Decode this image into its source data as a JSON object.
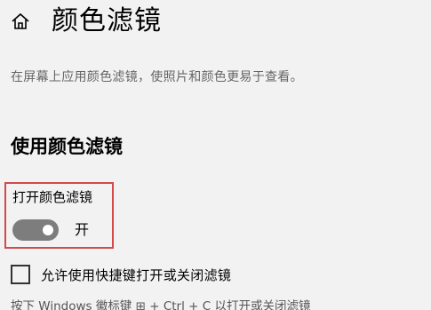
{
  "header": {
    "title": "颜色滤镜",
    "home_icon": "home-icon"
  },
  "description": "在屏幕上应用颜色滤镜，使照片和颜色更易于查看。",
  "section": {
    "title": "使用颜色滤镜",
    "toggle": {
      "label": "打开颜色滤镜",
      "state_text": "开",
      "on": true,
      "color": "#7d7d7d",
      "highlight_color": "#d24a4a"
    }
  },
  "shortcut": {
    "checked": false,
    "label": "允许使用快捷键打开或关闭滤镜"
  },
  "hint": "按下 Windows 徽标键 ⊞ + Ctrl + C 以打开或关闭滤镜"
}
